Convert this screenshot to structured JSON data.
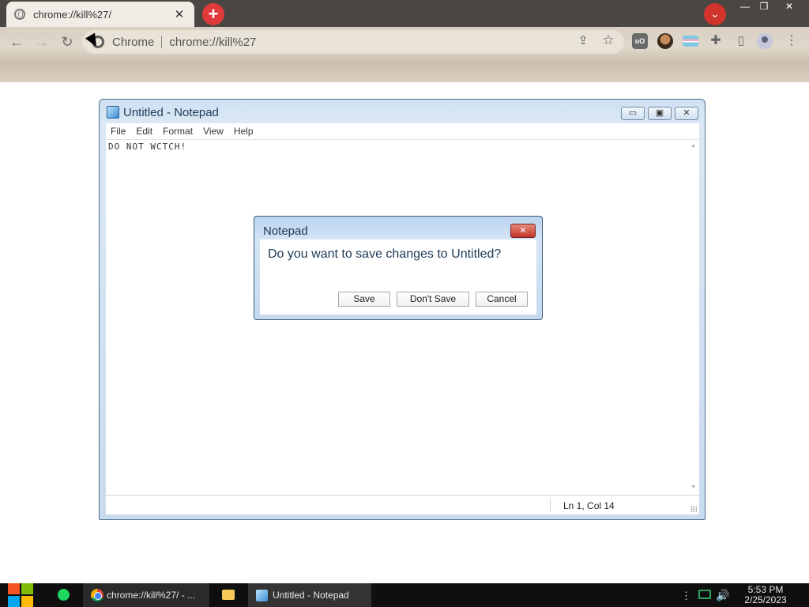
{
  "browser": {
    "tab_title": "chrome://kill%27/",
    "tab_close": "✕",
    "new_tab": "+",
    "tab_search": "⌄",
    "window_controls": {
      "minimize": "—",
      "restore": "❐",
      "close": "✕"
    },
    "nav": {
      "back": "←",
      "forward": "→",
      "reload": "↻"
    },
    "omnibox": {
      "site_name": "Chrome",
      "url": "chrome://kill%27"
    },
    "toolbar_icons": {
      "share": "⇪",
      "star": "☆",
      "ublock": "uO",
      "puzzle": "✚",
      "sidepanel": "▯",
      "menu": "⋮"
    }
  },
  "notepad": {
    "title": "Untitled - Notepad",
    "controls": {
      "minimize": "▭",
      "maximize": "▣",
      "close": "✕"
    },
    "menu": [
      "File",
      "Edit",
      "Format",
      "View",
      "Help"
    ],
    "content": "DO NOT WCTCH!",
    "scroll_up": "▲",
    "scroll_down": "▼",
    "status": "Ln 1, Col 14"
  },
  "dialog": {
    "title": "Notepad",
    "close": "✕",
    "message": "Do you want to save changes to Untitled?",
    "buttons": {
      "save": "Save",
      "dont_save": "Don't Save",
      "cancel": "Cancel"
    }
  },
  "taskbar": {
    "chrome_item": "chrome://kill%27/ - ...",
    "notepad_item": "Untitled - Notepad",
    "tray_dots": "⋮",
    "volume": "🔊",
    "time": "5:53 PM",
    "date": "2/25/2023"
  }
}
